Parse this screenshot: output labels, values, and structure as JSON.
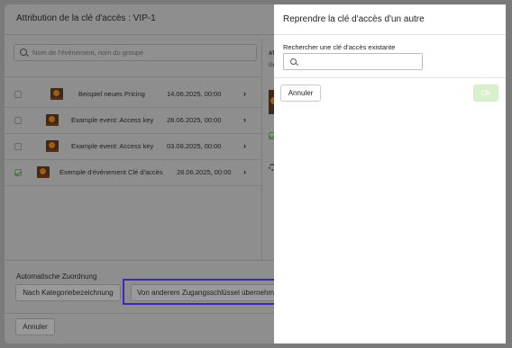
{
  "modal": {
    "title": "Attribution de la clé d'accès : VIP-1",
    "search_placeholder": "Nom de l'événement, nom du groupe",
    "events": [
      {
        "name": "Beispiel neues Pricing",
        "date": "14.06.2025, 00:00",
        "checked": false
      },
      {
        "name": "Example event: Access key",
        "date": "28.06.2025, 00:00",
        "checked": false
      },
      {
        "name": "Example event: Access key",
        "date": "03.08.2025, 00:00",
        "checked": false
      },
      {
        "name": "Exemple d'événement Clé d'accès",
        "date": "28.06.2025, 00:00",
        "checked": true
      }
    ],
    "side_label": "AT",
    "side_sub": "Ge",
    "auto_assign_label": "Automatische Zuordnung",
    "by_category_button": "Nach Kategoriebezeichnung",
    "from_other_key_button": "Von anderem Zugangsschlüssel übernehmen",
    "cancel_button": "Annuler"
  },
  "panel": {
    "title": "Reprendre la clé d'accès d'un autre",
    "search_label": "Rechercher une clé d'accès existante",
    "search_value": "",
    "cancel_button": "Annuler",
    "ok_button": "Ok"
  },
  "colors": {
    "highlight": "#3a27c0",
    "ok_button": "#d9f0cc"
  }
}
